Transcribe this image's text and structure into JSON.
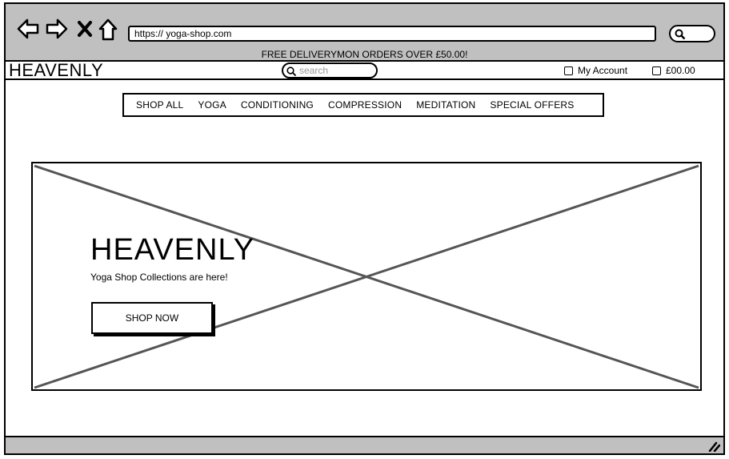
{
  "browser": {
    "url": "https:// yoga-shop.com"
  },
  "promo": {
    "text": "FREE DELIVERYMON ORDERS OVER £50.00!"
  },
  "header": {
    "logo": "HEAVENLY",
    "search_placeholder": "search",
    "account_label": "My Account",
    "cart_label": "£00.00"
  },
  "menu": {
    "items": [
      {
        "label": "SHOP ALL"
      },
      {
        "label": "YOGA"
      },
      {
        "label": "CONDITIONING"
      },
      {
        "label": "COMPRESSION"
      },
      {
        "label": "MEDITATION"
      },
      {
        "label": "SPECIAL OFFERS"
      }
    ]
  },
  "hero": {
    "title": "HEAVENLY",
    "subtitle": "Yoga Shop Collections are here!",
    "button_label": "SHOP NOW"
  },
  "icons": {
    "back": "arrow-left-icon",
    "forward": "arrow-right-icon",
    "close": "x-icon",
    "home": "home-icon",
    "search": "magnifier-icon",
    "checkbox": "checkbox-icon",
    "resize": "resize-grip-icon"
  },
  "colors": {
    "chrome": "#c0c0c0",
    "placeholder_cross": "#555555"
  }
}
